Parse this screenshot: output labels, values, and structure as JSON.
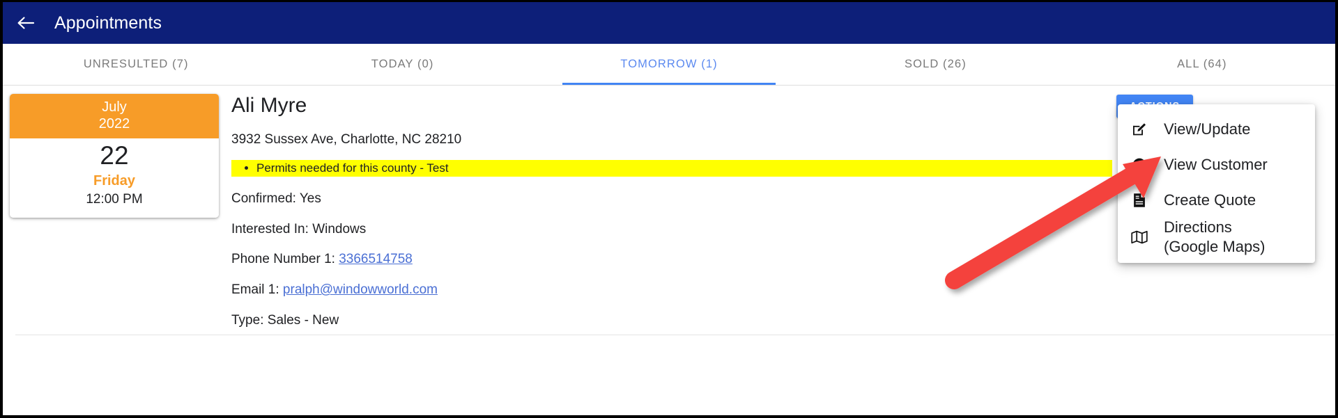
{
  "header": {
    "back_icon": "arrow-left-icon",
    "title": "Appointments",
    "bg_color": "#0d1f79"
  },
  "tabs": [
    {
      "label": "UNRESULTED (7)",
      "active": false
    },
    {
      "label": "TODAY (0)",
      "active": false
    },
    {
      "label": "TOMORROW (1)",
      "active": true
    },
    {
      "label": "SOLD (26)",
      "active": false
    },
    {
      "label": "ALL (64)",
      "active": false
    }
  ],
  "tab_active_color": "#5c8af0",
  "tab_underline_color": "#4285f4",
  "appointment": {
    "date_card": {
      "month": "July",
      "year": "2022",
      "day": "22",
      "weekday": "Friday",
      "time": "12:00 PM",
      "accent_color": "#f79c28"
    },
    "customer_name": "Ali Myre",
    "address": "3932 Sussex Ave, Charlotte, NC 28210",
    "note": "Permits needed for this county - Test",
    "note_highlight_color": "#ffff00",
    "details": [
      {
        "label": "Confirmed:",
        "value": "Yes",
        "link": false
      },
      {
        "label": "Interested In:",
        "value": "Windows",
        "link": false
      },
      {
        "label": "Phone Number 1:",
        "value": "3366514758",
        "link": true
      },
      {
        "label": "Email 1:",
        "value": "pralph@windowworld.com",
        "link": true
      },
      {
        "label": "Type:",
        "value": "Sales - New",
        "link": false
      }
    ]
  },
  "actions": {
    "button_label": "ACTIONS",
    "button_color": "#4285f4",
    "menu": [
      {
        "icon": "edit-square-icon",
        "label": "View/Update"
      },
      {
        "icon": "account-circle-icon",
        "label": "View Customer"
      },
      {
        "icon": "document-icon",
        "label": "Create Quote"
      },
      {
        "icon": "map-icon",
        "label": "Directions\n(Google Maps)"
      }
    ]
  },
  "annotation": {
    "type": "red-arrow",
    "color": "#f4433c",
    "points_to": "View/Update"
  }
}
